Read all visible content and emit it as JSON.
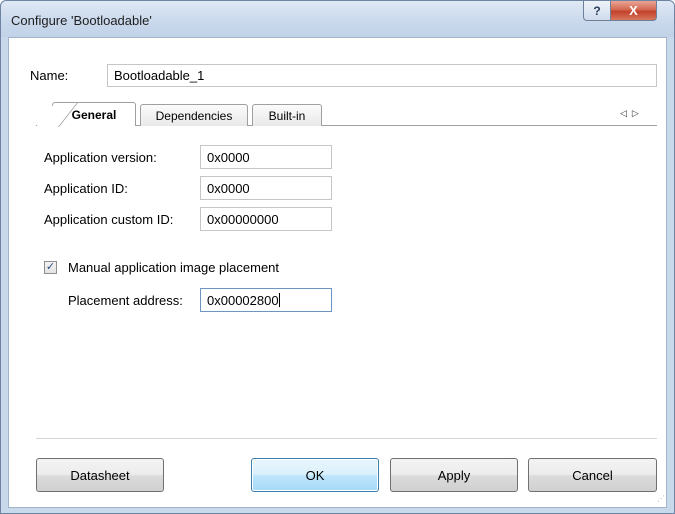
{
  "window": {
    "title": "Configure 'Bootloadable'",
    "help_glyph": "?",
    "close_glyph": "X"
  },
  "name": {
    "label": "Name:",
    "value": "Bootloadable_1"
  },
  "tabs": [
    {
      "label": "General",
      "active": true
    },
    {
      "label": "Dependencies",
      "active": false
    },
    {
      "label": "Built-in",
      "active": false
    }
  ],
  "tab_scroll": {
    "left_glyph": "◁",
    "right_glyph": "▷"
  },
  "general": {
    "app_version": {
      "label": "Application version:",
      "value": "0x0000"
    },
    "app_id": {
      "label": "Application ID:",
      "value": "0x0000"
    },
    "app_custom_id": {
      "label": "Application custom ID:",
      "value": "0x00000000"
    },
    "manual_placement": {
      "label": "Manual application image placement",
      "checked": true
    },
    "placement_address": {
      "label": "Placement address:",
      "value": "0x00002800"
    }
  },
  "buttons": {
    "datasheet": "Datasheet",
    "ok": "OK",
    "apply": "Apply",
    "cancel": "Cancel"
  },
  "colors": {
    "titlebar": "#c9d9ec",
    "close_button": "#c2412a",
    "default_button_border": "#3c7fb1"
  }
}
